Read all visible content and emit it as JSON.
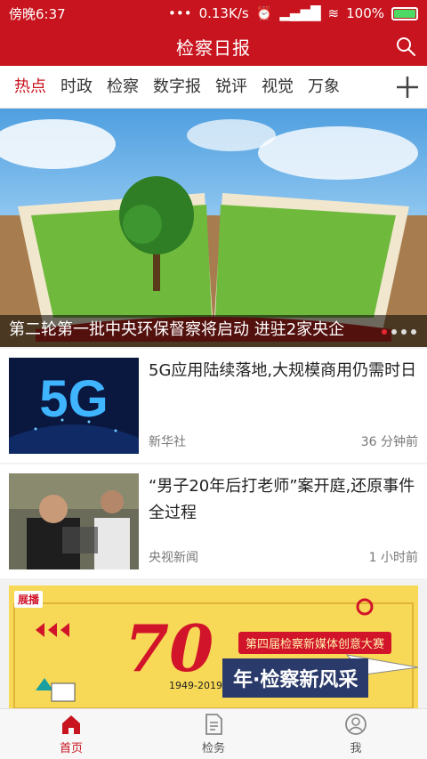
{
  "status_bar": {
    "time": "傍晚6:37",
    "network_speed": "0.13K/s",
    "battery": "100%",
    "battery_level": 1.0
  },
  "header": {
    "title": "检察日报",
    "search_icon": "search-icon"
  },
  "tabs": [
    {
      "label": "热点",
      "active": true
    },
    {
      "label": "时政"
    },
    {
      "label": "检察"
    },
    {
      "label": "数字报"
    },
    {
      "label": "锐评"
    },
    {
      "label": "视觉"
    },
    {
      "label": "万象"
    }
  ],
  "banner": {
    "caption": "第二轮第一批中央环保督察将启动 进驻2家央企",
    "dot_count": 4,
    "active_dot": 0
  },
  "news": [
    {
      "headline": "5G应用陆续落地,大规模商用仍需时日",
      "source": "新华社",
      "time": "36 分钟前"
    },
    {
      "headline": "“男子20年后打老师”案开庭,还原事件全过程",
      "source": "央视新闻",
      "time": "1 小时前"
    }
  ],
  "promo": {
    "tag": "展播",
    "big_number": "70",
    "years": "1949-2019",
    "contest": "第四届检察新媒体创意大赛",
    "slogan": "年·检察新风采",
    "thumb_text": "5G"
  },
  "bottom_nav": [
    {
      "label": "首页",
      "icon": "home-icon",
      "active": true
    },
    {
      "label": "检务",
      "icon": "document-icon"
    },
    {
      "label": "我",
      "icon": "user-icon"
    }
  ],
  "colors": {
    "brand_red": "#c8141e",
    "accent_red": "#e6262f"
  }
}
